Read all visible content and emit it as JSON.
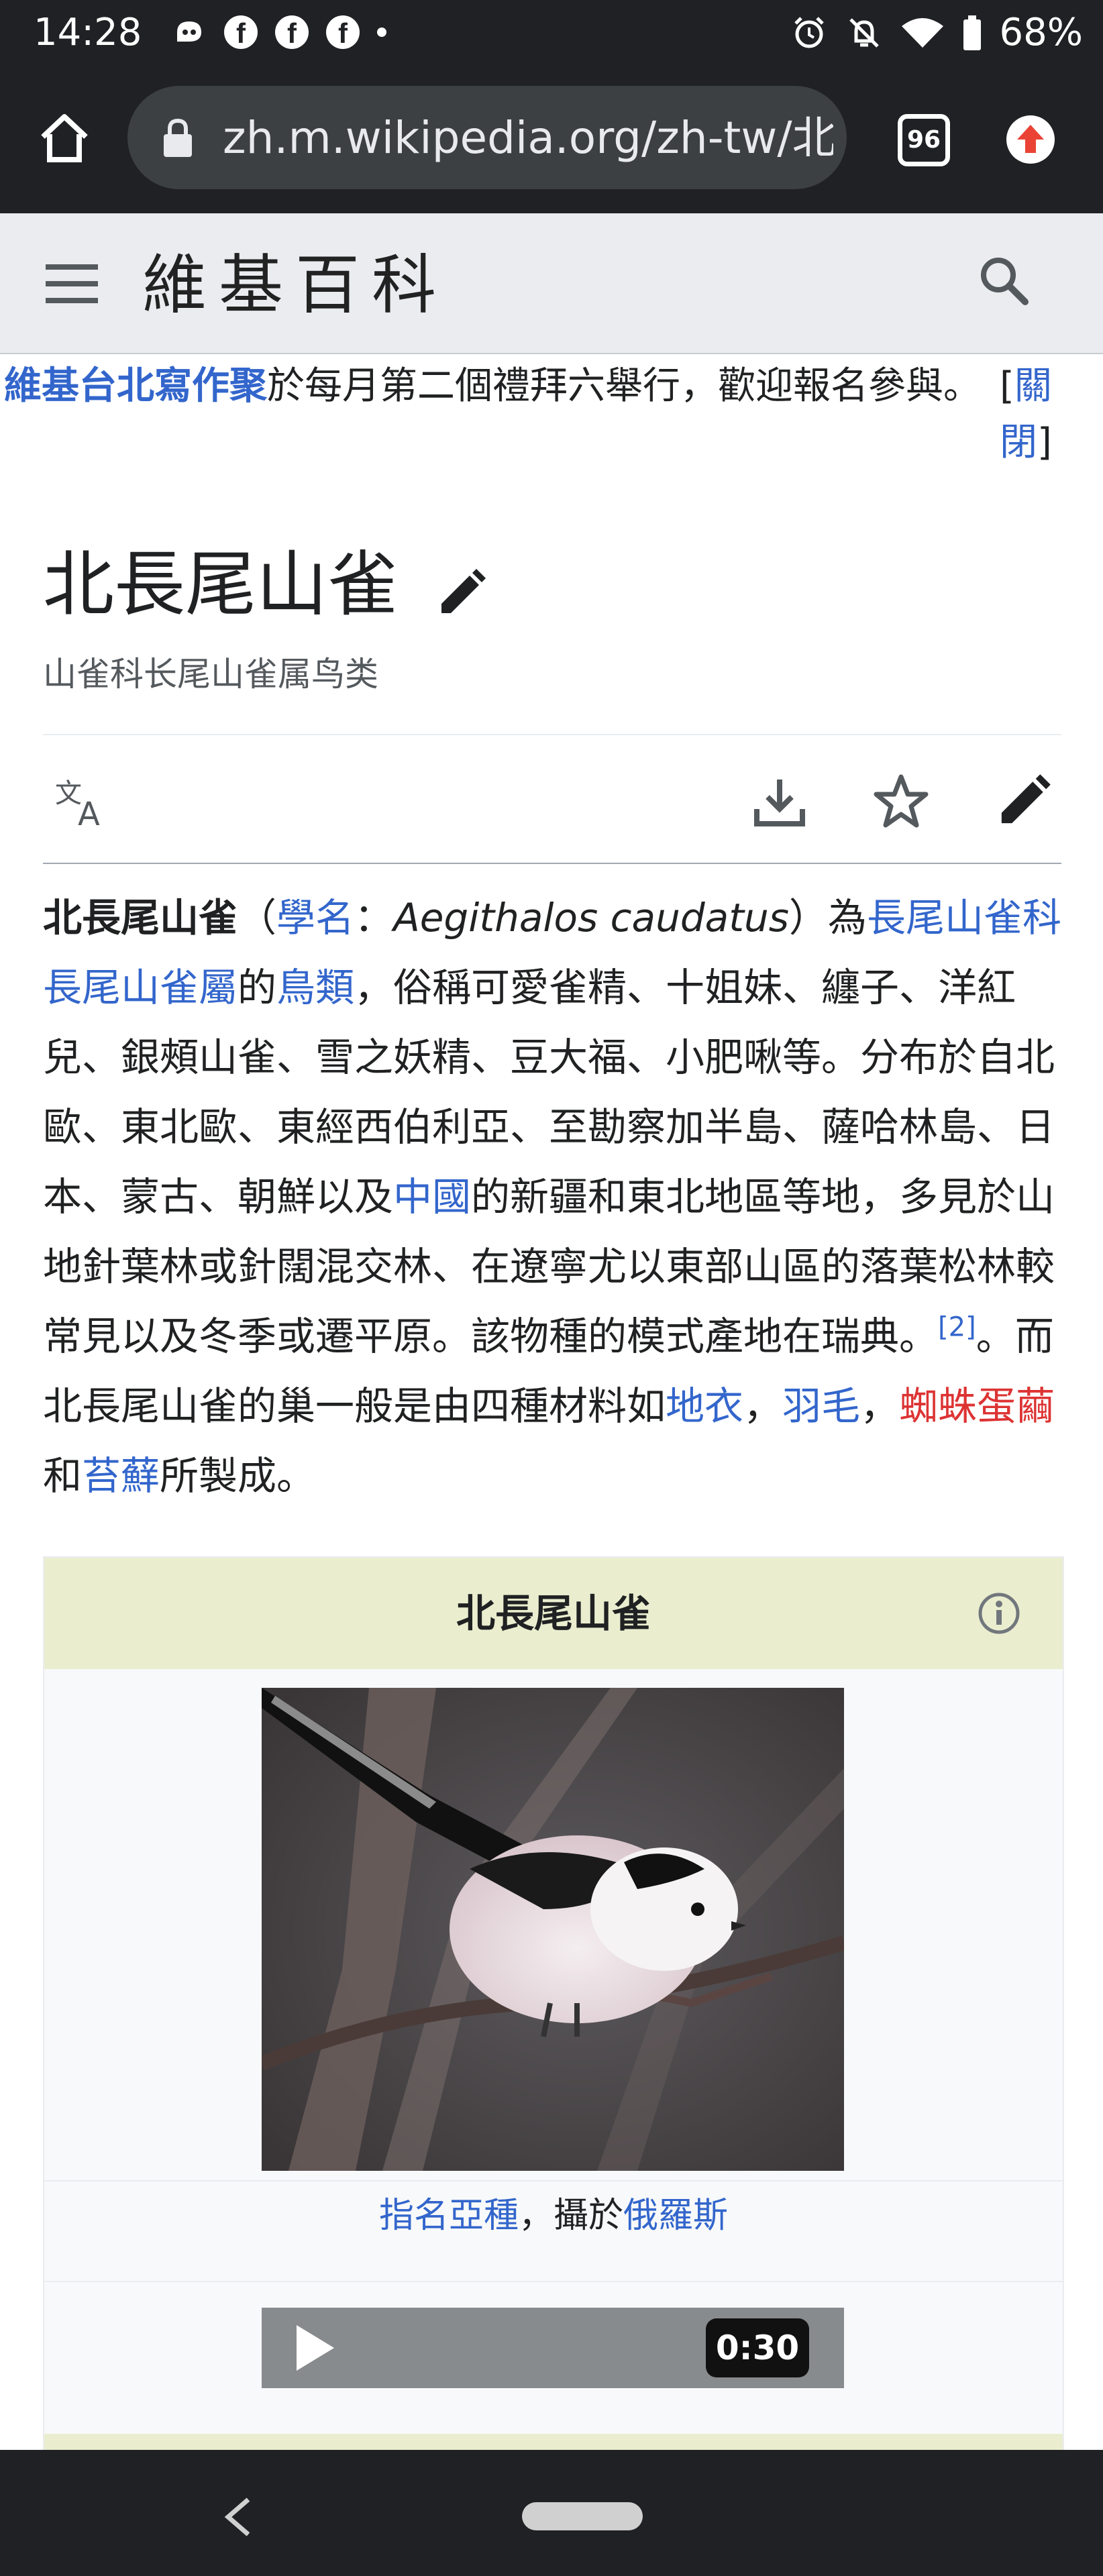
{
  "status_bar": {
    "time": "14:28",
    "notification_icons": [
      "messenger-icon",
      "facebook-icon",
      "facebook-icon",
      "facebook-icon",
      "dot-icon"
    ],
    "battery": "68%",
    "system_icons": [
      "alarm-icon",
      "bell-muted-icon",
      "wifi-icon",
      "battery-icon"
    ]
  },
  "browser": {
    "url": "zh.m.wikipedia.org/zh-tw/北長尾山雀",
    "tab_count": "96"
  },
  "wiki_header": {
    "wordmark": "維基百科"
  },
  "banner": {
    "link_text": "維基台北寫作聚",
    "text": "於每月第二個禮拜六舉行，歡迎報名參與。",
    "close_open": "[",
    "close_label": "關閉",
    "close_end": "]"
  },
  "page": {
    "title": "北長尾山雀",
    "subtitle": "山雀科长尾山雀属鸟类"
  },
  "article": {
    "t0": "北長尾山雀",
    "t1": "（",
    "l1": "學名",
    "t2": "：",
    "sci": "Aegithalos caudatus",
    "t3": "）為",
    "l2": "長尾山雀科",
    "l3": "長尾山雀屬",
    "t4": "的",
    "l4": "鳥類",
    "t5": "，俗稱可愛雀精、十姐妹、纏子、洋紅兒、銀頰山雀、雪之妖精、豆大福、小肥啾等。分布於自北歐、東北歐、東經西伯利亞、至勘察加半島、薩哈林島、日本、蒙古、朝鮮以及",
    "l5": "中國",
    "t6": "的新疆和東北地區等地，多見於山地針葉林或針闊混交林、在遼寧尤以東部山區的落葉松林較常見以及冬季或遷平原。該物種的模式產地在瑞典。",
    "ref": "[2]",
    "t7": "。而北長尾山雀的巢一般是由四種材料如",
    "l6": "地衣",
    "t8": "，",
    "l7": "羽毛",
    "t9": "，",
    "l8": "蜘蛛蛋繭",
    "t10": "和",
    "l9": "苔蘚",
    "t11": "所製成。"
  },
  "infobox": {
    "title": "北長尾山雀",
    "caption_link1": "指名亞種",
    "caption_text": "，攝於",
    "caption_link2": "俄羅斯",
    "audio_duration": "0:30"
  },
  "colors": {
    "link": "#3366cc",
    "redlink": "#dd3333",
    "chrome_dark": "#202124",
    "infobox_header": "#eaeecf"
  }
}
